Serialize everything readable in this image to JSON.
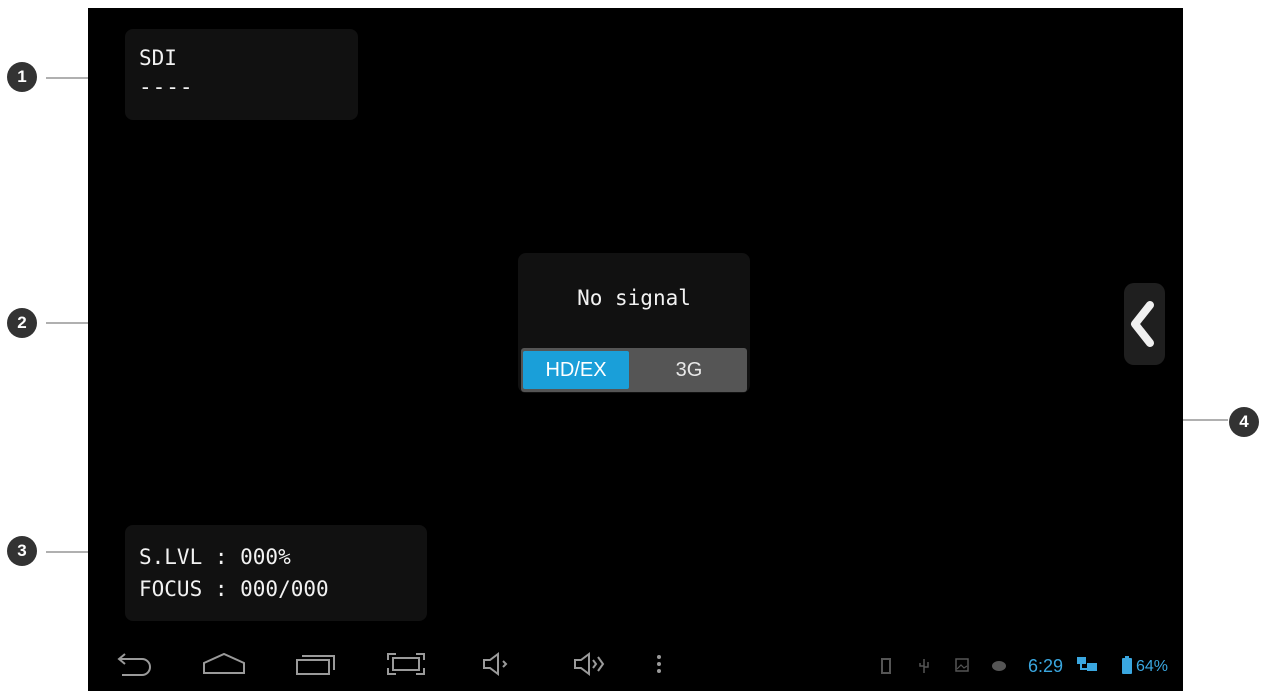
{
  "callouts": [
    "1",
    "2",
    "3",
    "4"
  ],
  "sdi": {
    "title": "SDI",
    "value": "----"
  },
  "signal": {
    "message": "No signal",
    "options": [
      "HD/EX",
      "3G"
    ],
    "selected": "HD/EX"
  },
  "status": {
    "level": "S.LVL : 000%",
    "focus": "FOCUS : 000/000"
  },
  "side_tab": {
    "icon": "chevron-left-icon"
  },
  "navbar": {
    "buttons": [
      "back-icon",
      "home-icon",
      "recent-apps-icon",
      "screenshot-icon",
      "volume-down-icon",
      "volume-up-icon",
      "menu-icon"
    ],
    "system_icons": [
      "sd-card-icon",
      "usb-icon",
      "image-icon",
      "android-icon",
      "network-icon",
      "battery-icon"
    ],
    "time": "6:29",
    "battery": "64%"
  },
  "colors": {
    "accent": "#1a9fd9",
    "status_text": "#3aa7e0",
    "background": "#000000"
  }
}
